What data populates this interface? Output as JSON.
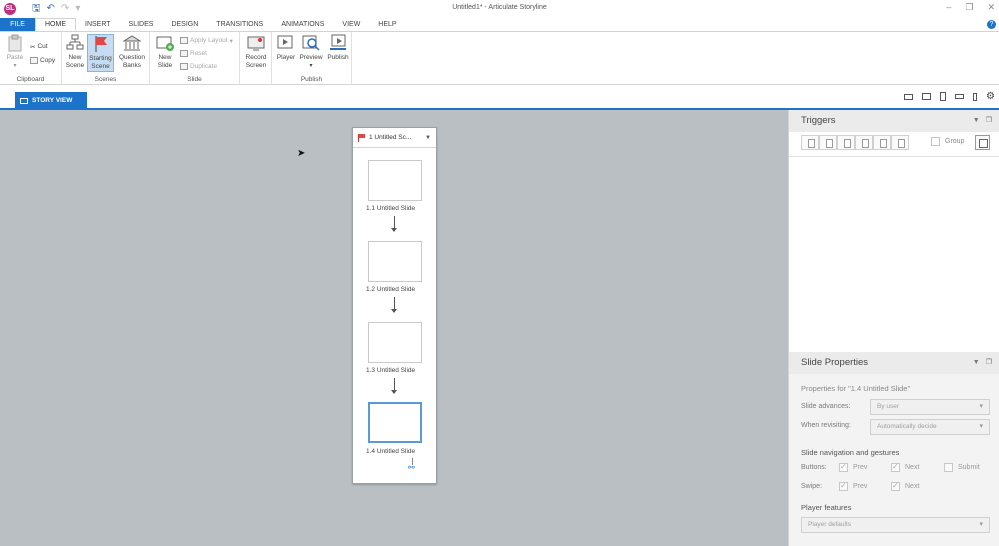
{
  "app": {
    "logo_text": "SL",
    "window_title": "Untitled1* - Articulate Storyline"
  },
  "ribbon_tabs": [
    "FILE",
    "HOME",
    "INSERT",
    "SLIDES",
    "DESIGN",
    "TRANSITIONS",
    "ANIMATIONS",
    "VIEW",
    "HELP"
  ],
  "ribbon": {
    "clipboard": {
      "label": "Clipboard",
      "paste": "Paste",
      "cut": "Cut",
      "copy": "Copy"
    },
    "scenes": {
      "label": "Scenes",
      "new_scene": "New Scene",
      "starting_scene": "Starting Scene",
      "question_banks": "Question Banks"
    },
    "slide": {
      "label": "Slide",
      "new_slide": "New Slide",
      "apply_layout": "Apply Layout",
      "reset": "Reset",
      "duplicate": "Duplicate"
    },
    "record": {
      "record_screen": "Record Screen"
    },
    "publish": {
      "label": "Publish",
      "player": "Player",
      "preview": "Preview",
      "publish": "Publish"
    }
  },
  "view_tab": {
    "label": "STORY VIEW"
  },
  "scene": {
    "title": "1 Untitled Sc...",
    "slides": [
      "1.1 Untitled Slide",
      "1.2 Untitled Slide",
      "1.3 Untitled Slide",
      "1.4 Untitled Slide"
    ],
    "selected_index": 3
  },
  "triggers": {
    "title": "Triggers",
    "group_label": "Group"
  },
  "slide_properties": {
    "title": "Slide Properties",
    "properties_for": "Properties for \"1.4 Untitled Slide\"",
    "slide_advances_label": "Slide advances:",
    "slide_advances_value": "By user",
    "when_revisiting_label": "When revisiting:",
    "when_revisiting_value": "Automatically decide",
    "nav_section": "Slide navigation and gestures",
    "buttons_label": "Buttons:",
    "swipe_label": "Swipe:",
    "prev": "Prev",
    "next": "Next",
    "submit": "Submit",
    "player_features": "Player features",
    "player_defaults": "Player defaults"
  }
}
